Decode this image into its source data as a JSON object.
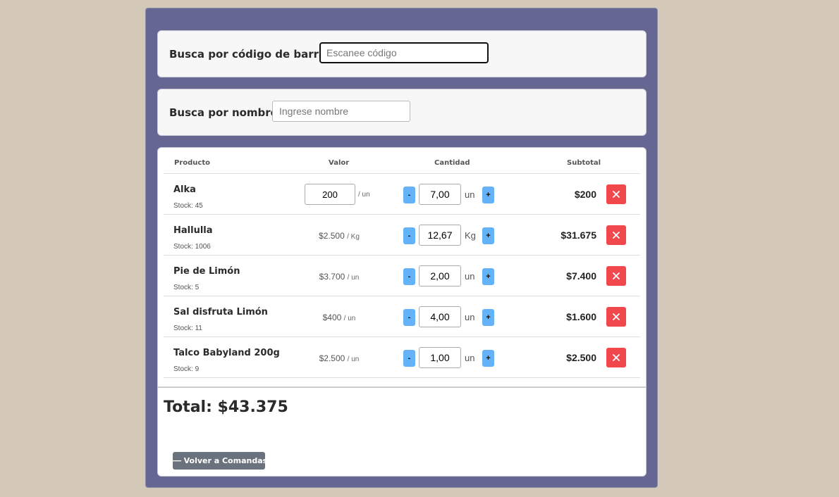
{
  "search_barcode": {
    "label": "Busca por código de barra:",
    "placeholder": "Escanee código"
  },
  "search_name": {
    "label": "Busca por nombre:",
    "placeholder": "Ingrese nombre"
  },
  "table": {
    "headers": {
      "product": "Producto",
      "value": "Valor",
      "quantity": "Cantidad",
      "subtotal": "Subtotal"
    },
    "rows": [
      {
        "name": "Alka",
        "stock": "Stock: 45",
        "price_value": "200",
        "price_unit": "/ un",
        "qty": "7,00",
        "qty_unit": "un",
        "subtotal": "$200"
      },
      {
        "name": "Hallulla",
        "stock": "Stock: 1006",
        "price": "$2.500",
        "price_unit": "/ Kg",
        "qty": "12,67",
        "qty_unit": "Kg",
        "subtotal": "$31.675"
      },
      {
        "name": "Pie de Limón",
        "stock": "Stock: 5",
        "price": "$3.700",
        "price_unit": "/ un",
        "qty": "2,00",
        "qty_unit": "un",
        "subtotal": "$7.400"
      },
      {
        "name": "Sal disfruta Limón",
        "stock": "Stock: 11",
        "price": "$400",
        "price_unit": "/ un",
        "qty": "4,00",
        "qty_unit": "un",
        "subtotal": "$1.600"
      },
      {
        "name": "Talco Babyland 200g",
        "stock": "Stock: 9",
        "price": "$2.500",
        "price_unit": "/ un",
        "qty": "1,00",
        "qty_unit": "un",
        "subtotal": "$2.500"
      }
    ],
    "minus_label": "-",
    "plus_label": "+"
  },
  "total": "Total: $43.375",
  "back_button": {
    "arrow": "⟵",
    "label": "Volver a Comandas"
  },
  "colors": {
    "page_bg": "#d4c8b8",
    "panel_bg": "#656691",
    "qty_button": "#64b2f7",
    "delete_button": "#f0484d",
    "back_button": "#6a737d"
  },
  "icons": {
    "delete": "close-icon",
    "back": "arrow-left-icon"
  }
}
